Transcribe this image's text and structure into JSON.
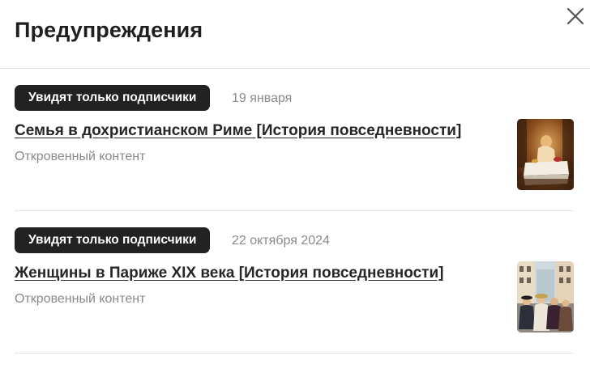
{
  "header": {
    "title": "Предупреждения"
  },
  "icons": {
    "close": "close-icon"
  },
  "notifications": [
    {
      "badge": "Увидят только подписчики",
      "date": "19 января",
      "title": "Семья в дохристианском Риме [История повседневности]",
      "subtitle": "Откровенный контент",
      "thumbnail": "roman-banquet-painting"
    },
    {
      "badge": "Увидят только подписчики",
      "date": "22 октября 2024",
      "title": "Женщины в Париже XIX века [История повседневности]",
      "subtitle": "Откровенный контент",
      "thumbnail": "paris-street-women-painting"
    }
  ],
  "colors": {
    "badge_bg": "#222222",
    "muted_text": "#8a8a8a",
    "divider": "#e6e6e6"
  }
}
